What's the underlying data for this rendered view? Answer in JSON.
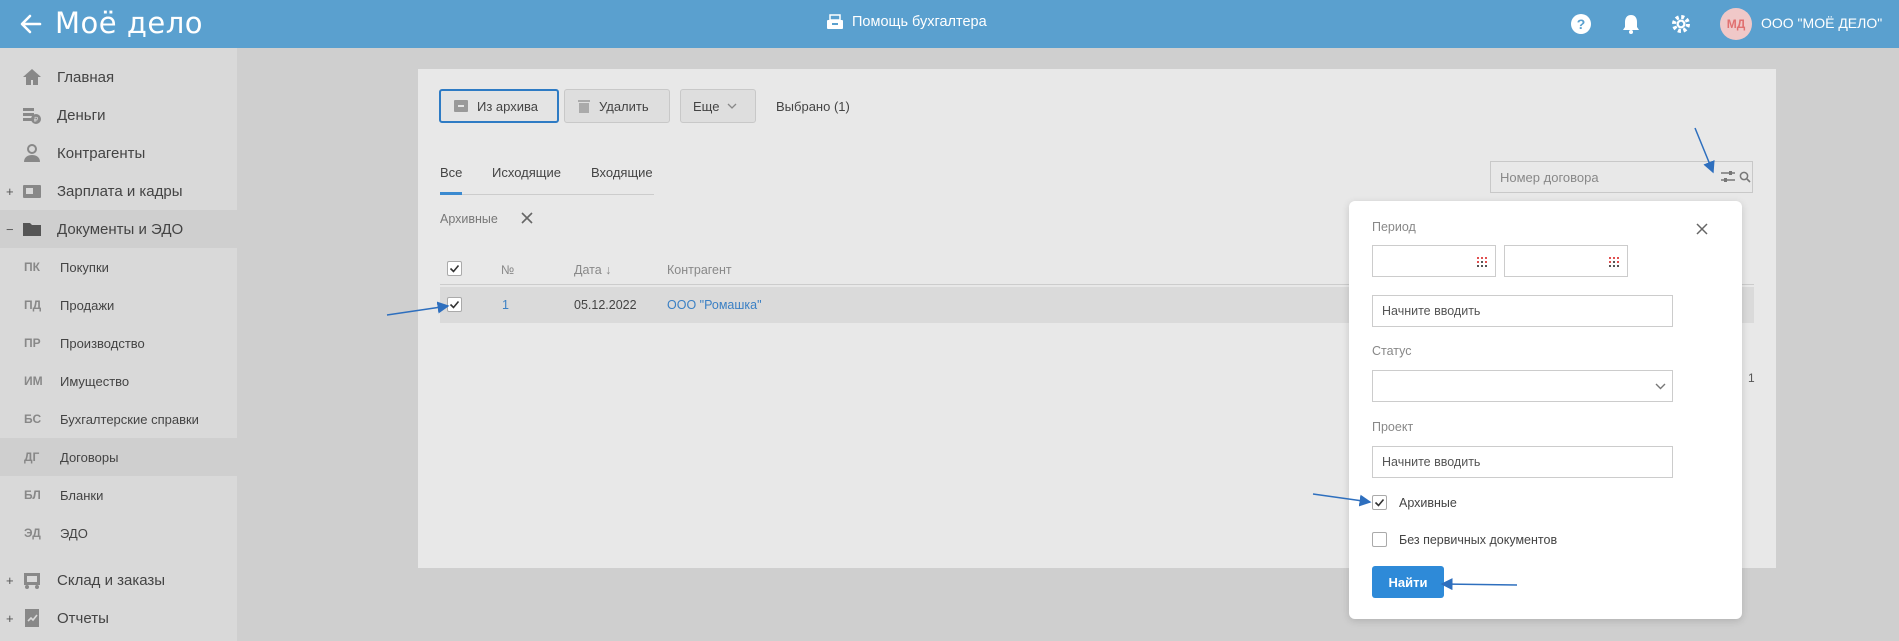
{
  "header": {
    "logo": "Моё дело",
    "helper": "Помощь бухгалтера",
    "avatar": "МД",
    "company": "ООО \"МОЁ ДЕЛО\""
  },
  "sidebar": {
    "items": [
      {
        "label": "Главная",
        "icon": "home-icon"
      },
      {
        "label": "Деньги",
        "icon": "money-icon"
      },
      {
        "label": "Контрагенты",
        "icon": "contractors-icon"
      },
      {
        "label": "Зарплата и кадры",
        "icon": "salary-icon",
        "toggle": "+"
      },
      {
        "label": "Документы и ЭДО",
        "icon": "folder-icon",
        "toggle": "−"
      }
    ],
    "subitems": [
      {
        "abbr": "ПК",
        "label": "Покупки"
      },
      {
        "abbr": "ПД",
        "label": "Продажи"
      },
      {
        "abbr": "ПР",
        "label": "Производство"
      },
      {
        "abbr": "ИМ",
        "label": "Имущество"
      },
      {
        "abbr": "БС",
        "label": "Бухгалтерские справки"
      },
      {
        "abbr": "ДГ",
        "label": "Договоры"
      },
      {
        "abbr": "БЛ",
        "label": "Бланки"
      },
      {
        "abbr": "ЭД",
        "label": "ЭДО"
      }
    ],
    "bottom": [
      {
        "label": "Склад и заказы",
        "icon": "warehouse-icon",
        "toggle": "+"
      },
      {
        "label": "Отчеты",
        "icon": "reports-icon",
        "toggle": "+"
      }
    ]
  },
  "toolbar": {
    "unarchive": "Из архива",
    "delete": "Удалить",
    "more": "Еще",
    "selected": "Выбрано (1)"
  },
  "tabs": [
    "Все",
    "Исходящие",
    "Входящие"
  ],
  "filter_tag": "Архивные",
  "search": {
    "placeholder": "Номер договора"
  },
  "table": {
    "headers": [
      "№",
      "Дата ↓",
      "Контрагент"
    ],
    "rows": [
      {
        "num": "1",
        "date": "05.12.2022",
        "contractor": "ООО \"Ромашка\"",
        "checked": true
      }
    ]
  },
  "pager": "1",
  "popup": {
    "period_label": "Период",
    "contractor_placeholder": "Начните вводить",
    "status_label": "Статус",
    "project_label": "Проект",
    "project_placeholder": "Начните вводить",
    "archived_label": "Архивные",
    "archived_checked": true,
    "noprimary_label": "Без первичных документов",
    "noprimary_checked": false,
    "find": "Найти"
  },
  "colors": {
    "header": "#5aa0cf",
    "accent": "#2e8ad8",
    "annotation": "#2e6fbe"
  }
}
